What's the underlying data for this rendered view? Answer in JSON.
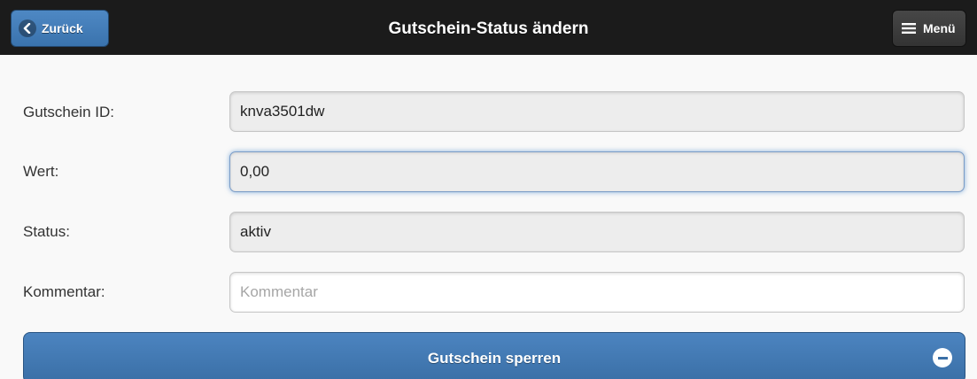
{
  "header": {
    "title": "Gutschein-Status ändern",
    "back_label": "Zurück",
    "menu_label": "Menü"
  },
  "form": {
    "gutschein_id": {
      "label": "Gutschein ID:",
      "value": "knva3501dw"
    },
    "wert": {
      "label": "Wert:",
      "value": "0,00"
    },
    "status": {
      "label": "Status:",
      "value": "aktiv"
    },
    "kommentar": {
      "label": "Kommentar:",
      "value": "",
      "placeholder": "Kommentar"
    }
  },
  "action": {
    "label": "Gutschein sperren"
  },
  "icons": {
    "back": "chevron-left-icon",
    "menu": "hamburger-icon",
    "action": "minus-circle-icon"
  },
  "colors": {
    "header_bg": "#1b1b1b",
    "accent": "#3a73ad"
  }
}
